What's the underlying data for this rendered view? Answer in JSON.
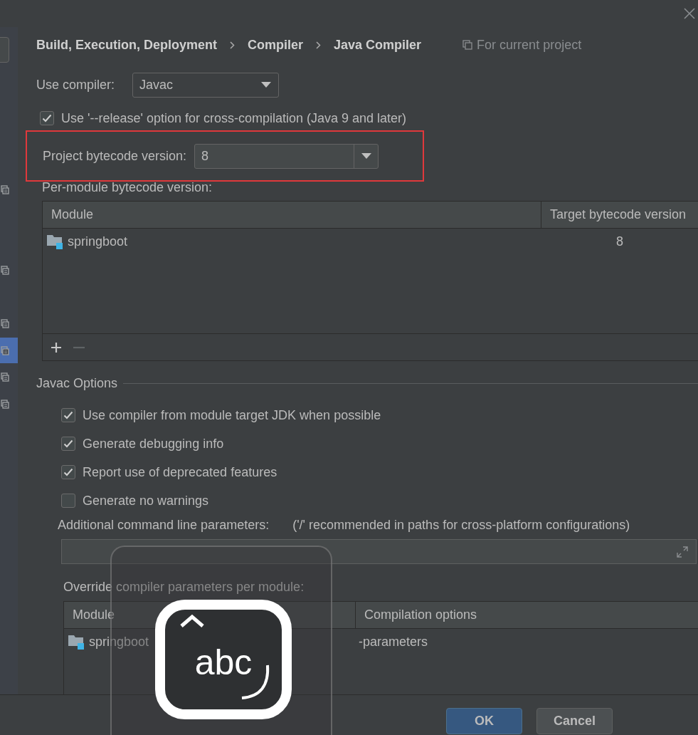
{
  "sidebar": {
    "items": [
      {
        "selected": false
      },
      {
        "selected": false
      },
      {
        "selected": false
      },
      {
        "selected": true
      },
      {
        "selected": false
      },
      {
        "selected": false
      }
    ]
  },
  "breadcrumb": [
    "Build, Execution, Deployment",
    "Compiler",
    "Java Compiler"
  ],
  "scope_label": "For current project",
  "use_compiler": {
    "label": "Use compiler:",
    "value": "Javac"
  },
  "release_option": {
    "label": "Use '--release' option for cross-compilation (Java 9 and later)",
    "checked": true
  },
  "project_bytecode": {
    "label": "Project bytecode version:",
    "value": "8",
    "highlighted": true
  },
  "per_module": {
    "label": "Per-module bytecode version:",
    "columns": [
      "Module",
      "Target bytecode version"
    ],
    "rows": [
      {
        "module": "springboot",
        "version": "8"
      }
    ]
  },
  "javac_options": {
    "title": "Javac Options",
    "options": [
      {
        "label": "Use compiler from module target JDK when possible",
        "checked": true
      },
      {
        "label": "Generate debugging info",
        "checked": true
      },
      {
        "label": "Report use of deprecated features",
        "checked": true
      },
      {
        "label": "Generate no warnings",
        "checked": false
      }
    ]
  },
  "additional_params": {
    "label": "Additional command line parameters:",
    "hint": "('/' recommended in paths for cross-platform configurations)"
  },
  "override": {
    "label": "Override compiler parameters per module:",
    "columns": [
      "Module",
      "Compilation options"
    ],
    "rows": [
      {
        "module": "springboot",
        "options": "-parameters"
      }
    ]
  },
  "buttons": [
    {
      "label": "OK",
      "primary": true
    },
    {
      "label": "Cancel",
      "primary": false
    }
  ],
  "input_indicator": {
    "text": "abc"
  }
}
